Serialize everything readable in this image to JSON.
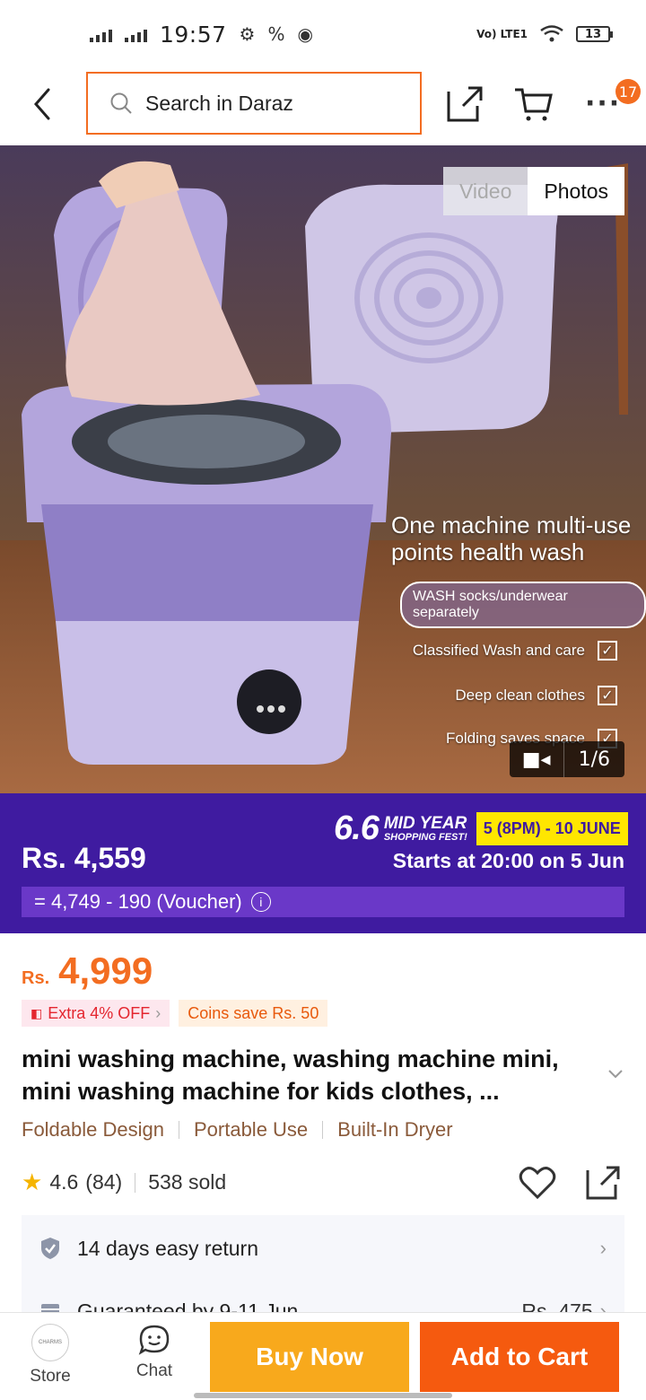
{
  "status_bar": {
    "time": "19:57",
    "network": "Vo) LTE1",
    "battery": "13"
  },
  "header": {
    "search_placeholder": "Search in Daraz",
    "cart_badge": "17"
  },
  "gallery": {
    "tabs": [
      "Video",
      "Photos"
    ],
    "active_tab": "Photos",
    "counter": "1/6",
    "image_text": {
      "headline": "One machine multi-use points health wash",
      "pill": "WASH socks/underwear separately",
      "features": [
        "Classified Wash and care",
        "Deep clean clothes",
        "Folding saves space"
      ]
    }
  },
  "campaign": {
    "price_now": "Rs. 4,559",
    "fest_number": "6.6",
    "fest_title": "MID YEAR",
    "fest_subtitle": "SHOPPING FEST!",
    "fest_dates": "5 (8PM) - 10 JUNE",
    "starts_at": "Starts at 20:00 on 5 Jun",
    "voucher_calc": "= 4,749 - 190 (Voucher)",
    "bg_color": "#3f1ba0"
  },
  "price": {
    "currency": "Rs.",
    "amount": "4,999"
  },
  "tags": {
    "extra_off": "Extra 4% OFF",
    "coins": "Coins save Rs. 50"
  },
  "product": {
    "title": "mini washing machine, washing machine mini, mini washing machine for kids clothes, ...",
    "highlights": [
      "Foldable Design",
      "Portable Use",
      "Built-In Dryer"
    ],
    "rating": "4.6",
    "review_count": "(84)",
    "sold": "538 sold"
  },
  "services": {
    "return_policy": "14 days easy return",
    "guarantee": "Guaranteed by 9-11 Jun",
    "delivery_fee": "Rs. 475"
  },
  "bottom_bar": {
    "store_label": "Store",
    "chat_label": "Chat",
    "buy_now_label": "Buy Now",
    "add_to_cart_label": "Add to Cart"
  },
  "colors": {
    "brand_orange": "#f36d21",
    "buy_now": "#f8a91c",
    "add_to_cart": "#f55a0f",
    "fest_yellow": "#ffe600"
  }
}
